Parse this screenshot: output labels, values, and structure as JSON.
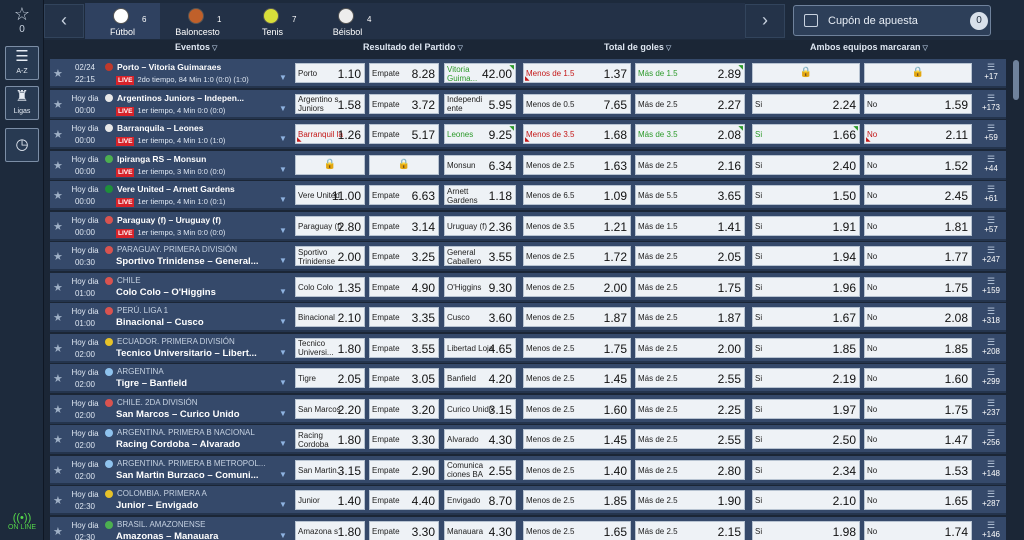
{
  "rail": {
    "favorites_count": "0",
    "az_label": "A-Z",
    "leagues_label": "Ligas",
    "online_label": "ON LINE"
  },
  "topbar": {
    "prev": "‹",
    "next": "›",
    "sports": [
      {
        "name": "Fútbol",
        "count": "6",
        "color": "#ffffff"
      },
      {
        "name": "Baloncesto",
        "count": "1",
        "color": "#c0602a"
      },
      {
        "name": "Tenis",
        "count": "7",
        "color": "#d8de3a"
      },
      {
        "name": "Béisbol",
        "count": "4",
        "color": "#ededed"
      }
    ],
    "coupon_title": "Cupón de apuesta",
    "coupon_count": "0"
  },
  "headers": {
    "events": "Eventos",
    "result": "Resultado del Partido",
    "goals": "Total de goles",
    "both": "Ambos equipos marcaran"
  },
  "rows": [
    {
      "date": "02/24",
      "time": "22:15",
      "title": "Porto – Vitoria Guimaraes",
      "live": true,
      "status": "2do tiempo, 84 Min 1:0 (0:0) (1:0)",
      "flag": "#c0392b",
      "odds": [
        {
          "l": "Porto",
          "v": "1.10"
        },
        {
          "l": "Empate",
          "v": "8.28"
        },
        {
          "l": "Vitoria Guima...",
          "v": "42.00",
          "c": "green",
          "up": true
        },
        {
          "l": "Menos de 1.5",
          "v": "1.37",
          "c": "red",
          "dn": true
        },
        {
          "l": "Más de 1.5",
          "v": "2.89",
          "c": "green",
          "up": true
        },
        {
          "lock": true
        },
        {
          "lock": true
        }
      ],
      "more": "+17"
    },
    {
      "date": "Hoy dia",
      "time": "00:00",
      "title": "Argentinos Juniors – Indepen...",
      "live": true,
      "status": "1er tiempo, 4 Min 0:0 (0:0)",
      "flag": "#e8e8e8",
      "odds": [
        {
          "l": "Argentino s Juniors",
          "v": "1.58"
        },
        {
          "l": "Empate",
          "v": "3.72"
        },
        {
          "l": "Independi ente",
          "v": "5.95"
        },
        {
          "l": "Menos de 0.5",
          "v": "7.65"
        },
        {
          "l": "Más de 2.5",
          "v": "2.27"
        },
        {
          "l": "Si",
          "v": "2.24"
        },
        {
          "l": "No",
          "v": "1.59"
        }
      ],
      "more": "+173"
    },
    {
      "date": "Hoy dia",
      "time": "00:00",
      "title": "Barranquila – Leones",
      "live": true,
      "status": "1er tiempo, 4 Min 1:0 (1:0)",
      "flag": "#e8e8e8",
      "odds": [
        {
          "l": "Barranquil la",
          "v": "1.26",
          "c": "red",
          "dn": true
        },
        {
          "l": "Empate",
          "v": "5.17"
        },
        {
          "l": "Leones",
          "v": "9.25",
          "c": "green",
          "up": true
        },
        {
          "l": "Menos de 3.5",
          "v": "1.68",
          "c": "red",
          "dn": true
        },
        {
          "l": "Más de 3.5",
          "v": "2.08",
          "c": "green",
          "up": true
        },
        {
          "l": "Si",
          "v": "1.66",
          "c": "green",
          "up": true
        },
        {
          "l": "No",
          "v": "2.11",
          "c": "red",
          "dn": true
        }
      ],
      "more": "+59"
    },
    {
      "date": "Hoy dia",
      "time": "00:00",
      "title": "Ipiranga RS – Monsun",
      "live": true,
      "status": "1er tiempo, 3 Min 0:0 (0:0)",
      "flag": "#4caf50",
      "odds": [
        {
          "lock": true
        },
        {
          "lock": true
        },
        {
          "l": "Monsun",
          "v": "6.34"
        },
        {
          "l": "Menos de 2.5",
          "v": "1.63"
        },
        {
          "l": "Más de 2.5",
          "v": "2.16"
        },
        {
          "l": "Si",
          "v": "2.40"
        },
        {
          "l": "No",
          "v": "1.52"
        }
      ],
      "more": "+44"
    },
    {
      "date": "Hoy dia",
      "time": "00:00",
      "title": "Vere United – Arnett Gardens",
      "live": true,
      "status": "1er tiempo, 4 Min 1:0 (0:1)",
      "flag": "#1e8f3a",
      "odds": [
        {
          "l": "Vere United",
          "v": "11.00"
        },
        {
          "l": "Empate",
          "v": "6.63"
        },
        {
          "l": "Arnett Gardens",
          "v": "1.18"
        },
        {
          "l": "Menos de 6.5",
          "v": "1.09"
        },
        {
          "l": "Más de 5.5",
          "v": "3.65"
        },
        {
          "l": "Si",
          "v": "1.50"
        },
        {
          "l": "No",
          "v": "2.45"
        }
      ],
      "more": "+61"
    },
    {
      "date": "Hoy dia",
      "time": "00:00",
      "title": "Paraguay (f) – Uruguay (f)",
      "live": true,
      "status": "1er tiempo, 3 Min 0:0 (0:0)",
      "flag": "#d9534f",
      "odds": [
        {
          "l": "Paraguay (f)",
          "v": "2.80"
        },
        {
          "l": "Empate",
          "v": "3.14"
        },
        {
          "l": "Uruguay (f)",
          "v": "2.36"
        },
        {
          "l": "Menos de 3.5",
          "v": "1.21"
        },
        {
          "l": "Más de 1.5",
          "v": "1.41"
        },
        {
          "l": "Si",
          "v": "1.91"
        },
        {
          "l": "No",
          "v": "1.81"
        }
      ],
      "more": "+57"
    },
    {
      "date": "Hoy dia",
      "time": "00:30",
      "league": "PARAGUAY. PRIMERA DIVISIÓN",
      "title": "Sportivo Trinidense – General...",
      "flag": "#d9534f",
      "odds": [
        {
          "l": "Sportivo Trinidense",
          "v": "2.00"
        },
        {
          "l": "Empate",
          "v": "3.25"
        },
        {
          "l": "General Caballero",
          "v": "3.55"
        },
        {
          "l": "Menos de 2.5",
          "v": "1.72"
        },
        {
          "l": "Más de 2.5",
          "v": "2.05"
        },
        {
          "l": "Si",
          "v": "1.94"
        },
        {
          "l": "No",
          "v": "1.77"
        }
      ],
      "more": "+247"
    },
    {
      "date": "Hoy dia",
      "time": "01:00",
      "league": "CHILE",
      "title": "Colo Colo – O'Higgins",
      "flag": "#d9534f",
      "odds": [
        {
          "l": "Colo Colo",
          "v": "1.35"
        },
        {
          "l": "Empate",
          "v": "4.90"
        },
        {
          "l": "O'Higgins",
          "v": "9.30"
        },
        {
          "l": "Menos de 2.5",
          "v": "2.00"
        },
        {
          "l": "Más de 2.5",
          "v": "1.75"
        },
        {
          "l": "Si",
          "v": "1.96"
        },
        {
          "l": "No",
          "v": "1.75"
        }
      ],
      "more": "+159"
    },
    {
      "date": "Hoy dia",
      "time": "01:00",
      "league": "PERÚ. LIGA 1",
      "title": "Binacional – Cusco",
      "flag": "#d9534f",
      "odds": [
        {
          "l": "Binacional",
          "v": "2.10"
        },
        {
          "l": "Empate",
          "v": "3.35"
        },
        {
          "l": "Cusco",
          "v": "3.60"
        },
        {
          "l": "Menos de 2.5",
          "v": "1.87"
        },
        {
          "l": "Más de 2.5",
          "v": "1.87"
        },
        {
          "l": "Si",
          "v": "1.67"
        },
        {
          "l": "No",
          "v": "2.08"
        }
      ],
      "more": "+318"
    },
    {
      "date": "Hoy dia",
      "time": "02:00",
      "league": "ECUADOR. PRIMERA DIVISIÓN",
      "title": "Tecnico Universitario – Libert...",
      "flag": "#e6c229",
      "odds": [
        {
          "l": "Tecnico Universi...",
          "v": "1.80"
        },
        {
          "l": "Empate",
          "v": "3.55"
        },
        {
          "l": "Libertad Loja",
          "v": "4.65"
        },
        {
          "l": "Menos de 2.5",
          "v": "1.75"
        },
        {
          "l": "Más de 2.5",
          "v": "2.00"
        },
        {
          "l": "Si",
          "v": "1.85"
        },
        {
          "l": "No",
          "v": "1.85"
        }
      ],
      "more": "+208"
    },
    {
      "date": "Hoy dia",
      "time": "02:00",
      "league": "ARGENTINA",
      "title": "Tigre – Banfield",
      "flag": "#8fc3ee",
      "odds": [
        {
          "l": "Tigre",
          "v": "2.05"
        },
        {
          "l": "Empate",
          "v": "3.05"
        },
        {
          "l": "Banfield",
          "v": "4.20"
        },
        {
          "l": "Menos de 2.5",
          "v": "1.45"
        },
        {
          "l": "Más de 2.5",
          "v": "2.55"
        },
        {
          "l": "Si",
          "v": "2.19"
        },
        {
          "l": "No",
          "v": "1.60"
        }
      ],
      "more": "+299"
    },
    {
      "date": "Hoy dia",
      "time": "02:00",
      "league": "CHILE. 2DA DIVISIÓN",
      "title": "San Marcos – Curico Unido",
      "flag": "#d9534f",
      "odds": [
        {
          "l": "San Marcos",
          "v": "2.20"
        },
        {
          "l": "Empate",
          "v": "3.20"
        },
        {
          "l": "Curico Unido",
          "v": "3.15"
        },
        {
          "l": "Menos de 2.5",
          "v": "1.60"
        },
        {
          "l": "Más de 2.5",
          "v": "2.25"
        },
        {
          "l": "Si",
          "v": "1.97"
        },
        {
          "l": "No",
          "v": "1.75"
        }
      ],
      "more": "+237"
    },
    {
      "date": "Hoy dia",
      "time": "02:00",
      "league": "ARGENTINA. PRIMERA B NACIONAL",
      "title": "Racing Cordoba – Alvarado",
      "flag": "#8fc3ee",
      "odds": [
        {
          "l": "Racing Cordoba",
          "v": "1.80"
        },
        {
          "l": "Empate",
          "v": "3.30"
        },
        {
          "l": "Alvarado",
          "v": "4.30"
        },
        {
          "l": "Menos de 2.5",
          "v": "1.45"
        },
        {
          "l": "Más de 2.5",
          "v": "2.55"
        },
        {
          "l": "Si",
          "v": "2.50"
        },
        {
          "l": "No",
          "v": "1.47"
        }
      ],
      "more": "+256"
    },
    {
      "date": "Hoy dia",
      "time": "02:00",
      "league": "ARGENTINA. PRIMERA B METROPOL...",
      "title": "San Martin Burzaco – Comuni...",
      "flag": "#8fc3ee",
      "odds": [
        {
          "l": "San Martin...",
          "v": "3.15"
        },
        {
          "l": "Empate",
          "v": "2.90"
        },
        {
          "l": "Comunica ciones BA",
          "v": "2.55"
        },
        {
          "l": "Menos de 2.5",
          "v": "1.40"
        },
        {
          "l": "Más de 2.5",
          "v": "2.80"
        },
        {
          "l": "Si",
          "v": "2.34"
        },
        {
          "l": "No",
          "v": "1.53"
        }
      ],
      "more": "+148"
    },
    {
      "date": "Hoy dia",
      "time": "02:30",
      "league": "COLOMBIA. PRIMERA A",
      "title": "Junior – Envigado",
      "flag": "#e6c229",
      "odds": [
        {
          "l": "Junior",
          "v": "1.40"
        },
        {
          "l": "Empate",
          "v": "4.40"
        },
        {
          "l": "Envigado",
          "v": "8.70"
        },
        {
          "l": "Menos de 2.5",
          "v": "1.85"
        },
        {
          "l": "Más de 2.5",
          "v": "1.90"
        },
        {
          "l": "Si",
          "v": "2.10"
        },
        {
          "l": "No",
          "v": "1.65"
        }
      ],
      "more": "+287"
    },
    {
      "date": "Hoy dia",
      "time": "02:30",
      "league": "BRASIL. AMAZONENSE",
      "title": "Amazonas – Manauara",
      "flag": "#4caf50",
      "odds": [
        {
          "l": "Amazona s",
          "v": "1.80"
        },
        {
          "l": "Empate",
          "v": "3.30"
        },
        {
          "l": "Manauara",
          "v": "4.30"
        },
        {
          "l": "Menos de 2.5",
          "v": "1.65"
        },
        {
          "l": "Más de 2.5",
          "v": "2.15"
        },
        {
          "l": "Si",
          "v": "1.98"
        },
        {
          "l": "No",
          "v": "1.74"
        }
      ],
      "more": "+146"
    }
  ]
}
